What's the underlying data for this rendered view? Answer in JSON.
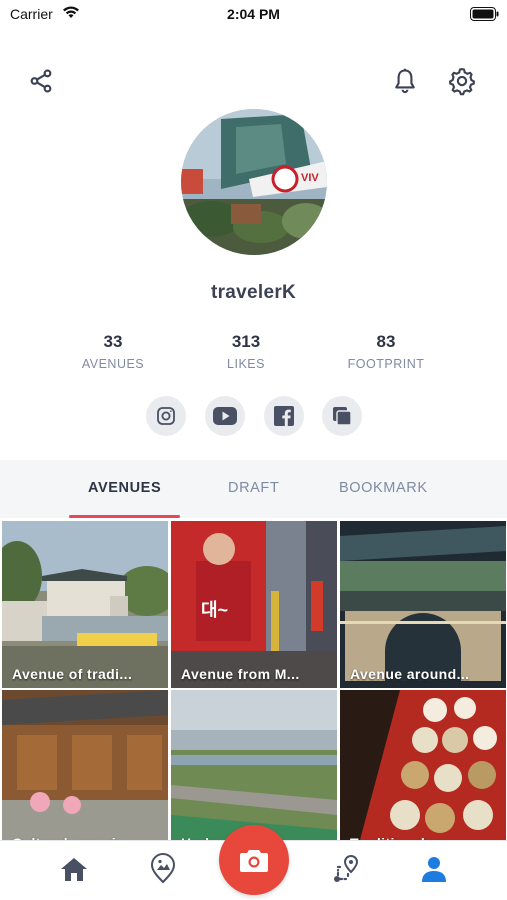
{
  "status_bar": {
    "carrier": "Carrier",
    "time": "2:04 PM"
  },
  "header": {
    "left_icon": "share-icon",
    "right_icons": [
      "bell-icon",
      "gear-icon"
    ]
  },
  "profile": {
    "username": "travelerK",
    "stats": [
      {
        "value": "33",
        "label": "AVENUES"
      },
      {
        "value": "313",
        "label": "LIKES"
      },
      {
        "value": "83",
        "label": "FOOTPRINT"
      }
    ],
    "social": [
      "instagram-icon",
      "youtube-icon",
      "facebook-icon",
      "copy-icon"
    ]
  },
  "tabs": [
    {
      "label": "AVENUES",
      "active": true
    },
    {
      "label": "DRAFT",
      "active": false
    },
    {
      "label": "BOOKMARK",
      "active": false
    }
  ],
  "avenues": [
    {
      "title": "Avenue of tradi..."
    },
    {
      "title": "Avenue from M..."
    },
    {
      "title": "Avenue around..."
    },
    {
      "title": "Cultural experi..."
    },
    {
      "title": "Hudson River..."
    },
    {
      "title": "Traditional mar..."
    }
  ],
  "bottom_nav": [
    "home-icon",
    "map-pin-icon",
    "camera-icon",
    "route-icon",
    "profile-icon"
  ],
  "colors": {
    "accent": "#e8475a",
    "camera": "#e8473c",
    "active_nav": "#1e7be0",
    "text": "#3c4254",
    "muted": "#7f8aa3"
  }
}
